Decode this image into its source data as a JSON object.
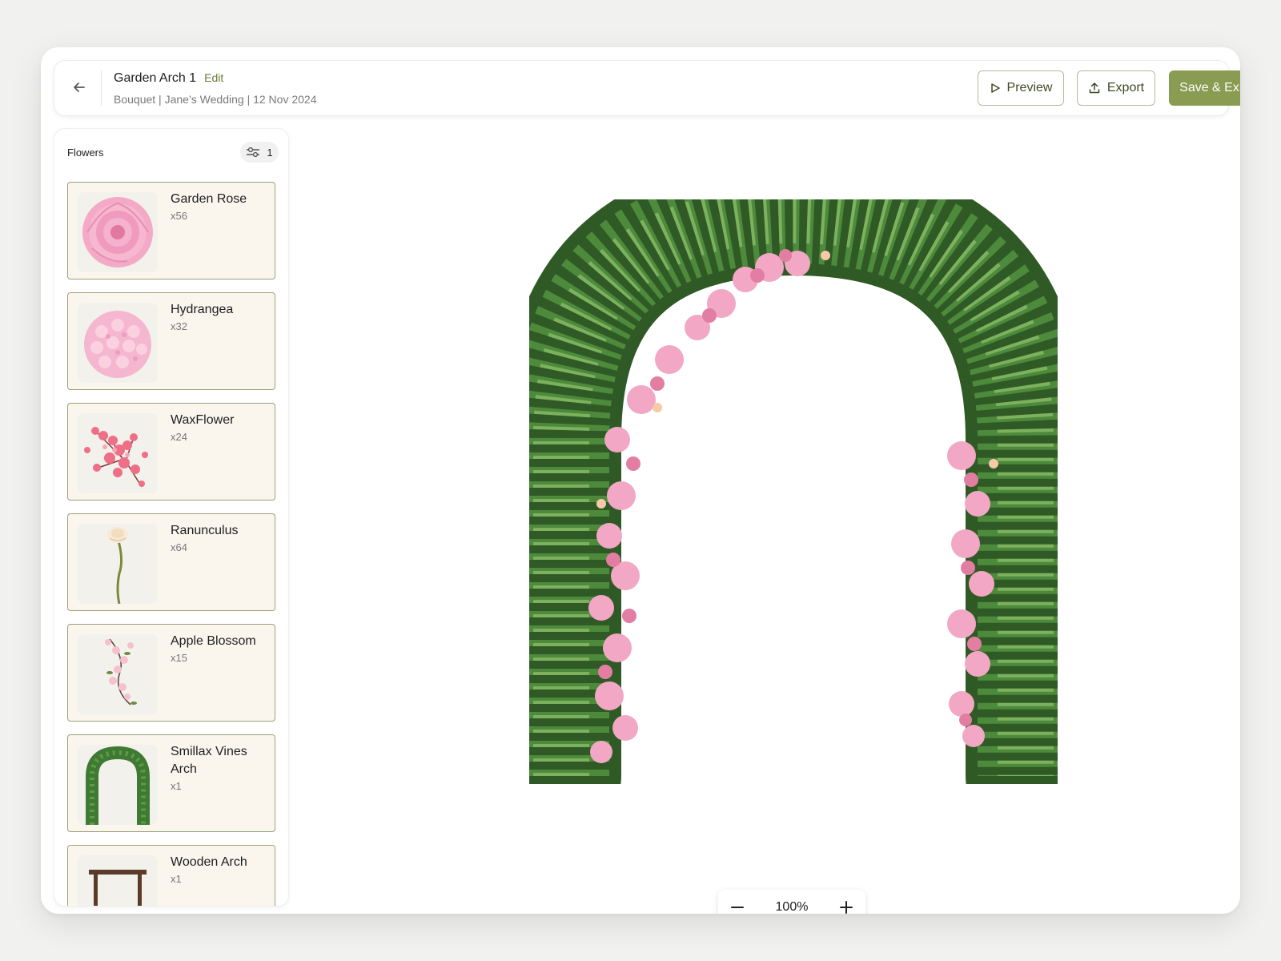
{
  "header": {
    "title": "Garden Arch 1",
    "edit_label": "Edit",
    "subtitle": "Bouquet | Jane’s Wedding | 12 Nov 2024",
    "preview_label": "Preview",
    "export_label": "Export",
    "save_label": "Save & Exit",
    "accent_color": "#8a9b52"
  },
  "sidebar": {
    "title": "Flowers",
    "filter_count": "1",
    "items": [
      {
        "name": "Garden Rose",
        "qty": "x56",
        "icon": "garden-rose"
      },
      {
        "name": "Hydrangea",
        "qty": "x32",
        "icon": "hydrangea"
      },
      {
        "name": "WaxFlower",
        "qty": "x24",
        "icon": "waxflower"
      },
      {
        "name": "Ranunculus",
        "qty": "x64",
        "icon": "ranunculus"
      },
      {
        "name": "Apple Blossom",
        "qty": "x15",
        "icon": "apple-blossom"
      },
      {
        "name": "Smillax Vines Arch",
        "qty": "x1",
        "icon": "smilax-arch"
      },
      {
        "name": "Wooden Arch",
        "qty": "x1",
        "icon": "wooden-arch"
      }
    ]
  },
  "canvas": {
    "zoom": "100%"
  }
}
